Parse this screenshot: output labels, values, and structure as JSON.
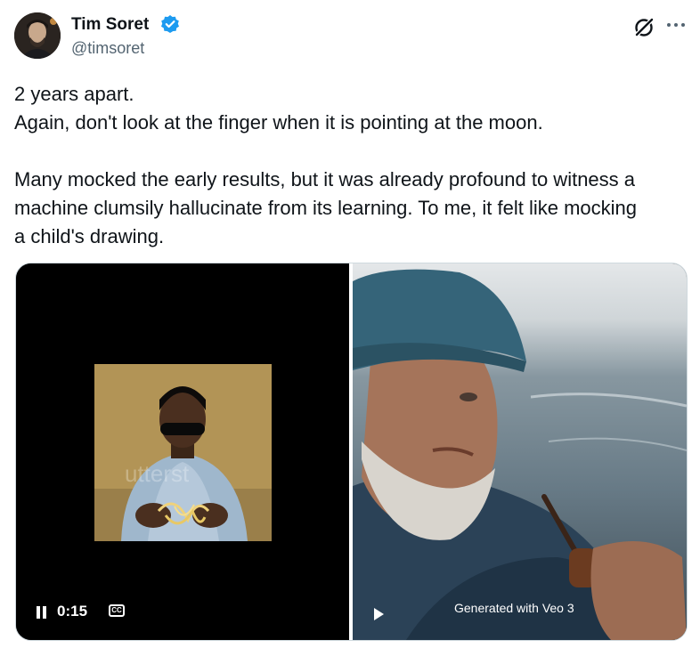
{
  "author": {
    "name": "Tim Soret",
    "handle": "@timsoret",
    "verified": true,
    "verified_color": "#1d9bf0"
  },
  "tweet": {
    "lines": [
      "2 years apart.",
      "Again, don't look at the finger when it is pointing at the moon.",
      "Many mocked the early results, but it was already profound to witness a",
      "machine clumsily hallucinate from its learning. To me, it felt like mocking",
      "a child's drawing."
    ]
  },
  "media": {
    "left_video": {
      "time": "0:15",
      "cc_label": "CC",
      "state": "playing",
      "watermark": "utterstock"
    },
    "right_video": {
      "caption": "Generated with Veo 3",
      "state": "paused"
    }
  },
  "icons": {
    "avatar": "avatar-image",
    "verified": "verified-badge-icon",
    "grok": "grok-icon",
    "more": "more-options-icon",
    "pause": "pause-icon",
    "cc": "closed-captions-icon",
    "play": "play-icon"
  }
}
